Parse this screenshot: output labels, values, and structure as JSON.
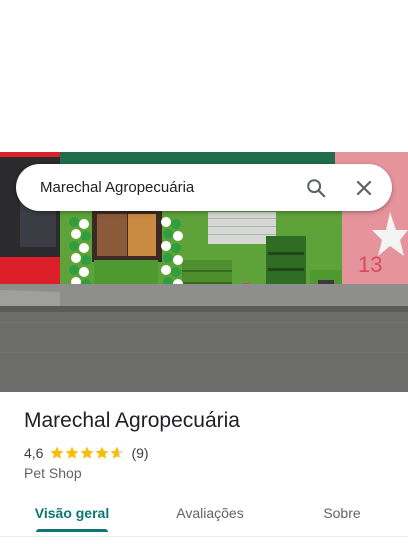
{
  "search": {
    "query": "Marechal Agropecuária",
    "search_icon": "search-icon",
    "close_icon": "close-icon"
  },
  "photo": {
    "shop_sign_number": "13"
  },
  "place": {
    "name": "Marechal Agropecuária",
    "rating": "4,6",
    "rating_value": 4.6,
    "review_count": "(9)",
    "category": "Pet Shop"
  },
  "tabs": [
    {
      "label": "Visão geral",
      "active": true
    },
    {
      "label": "Avaliações",
      "active": false
    },
    {
      "label": "Sobre",
      "active": false
    }
  ],
  "colors": {
    "accent": "#0b7676",
    "star": "#fbbc04",
    "star_empty": "#dadce0",
    "storefront_green": "#5ea33a",
    "neighbor_red": "#e8202a"
  }
}
